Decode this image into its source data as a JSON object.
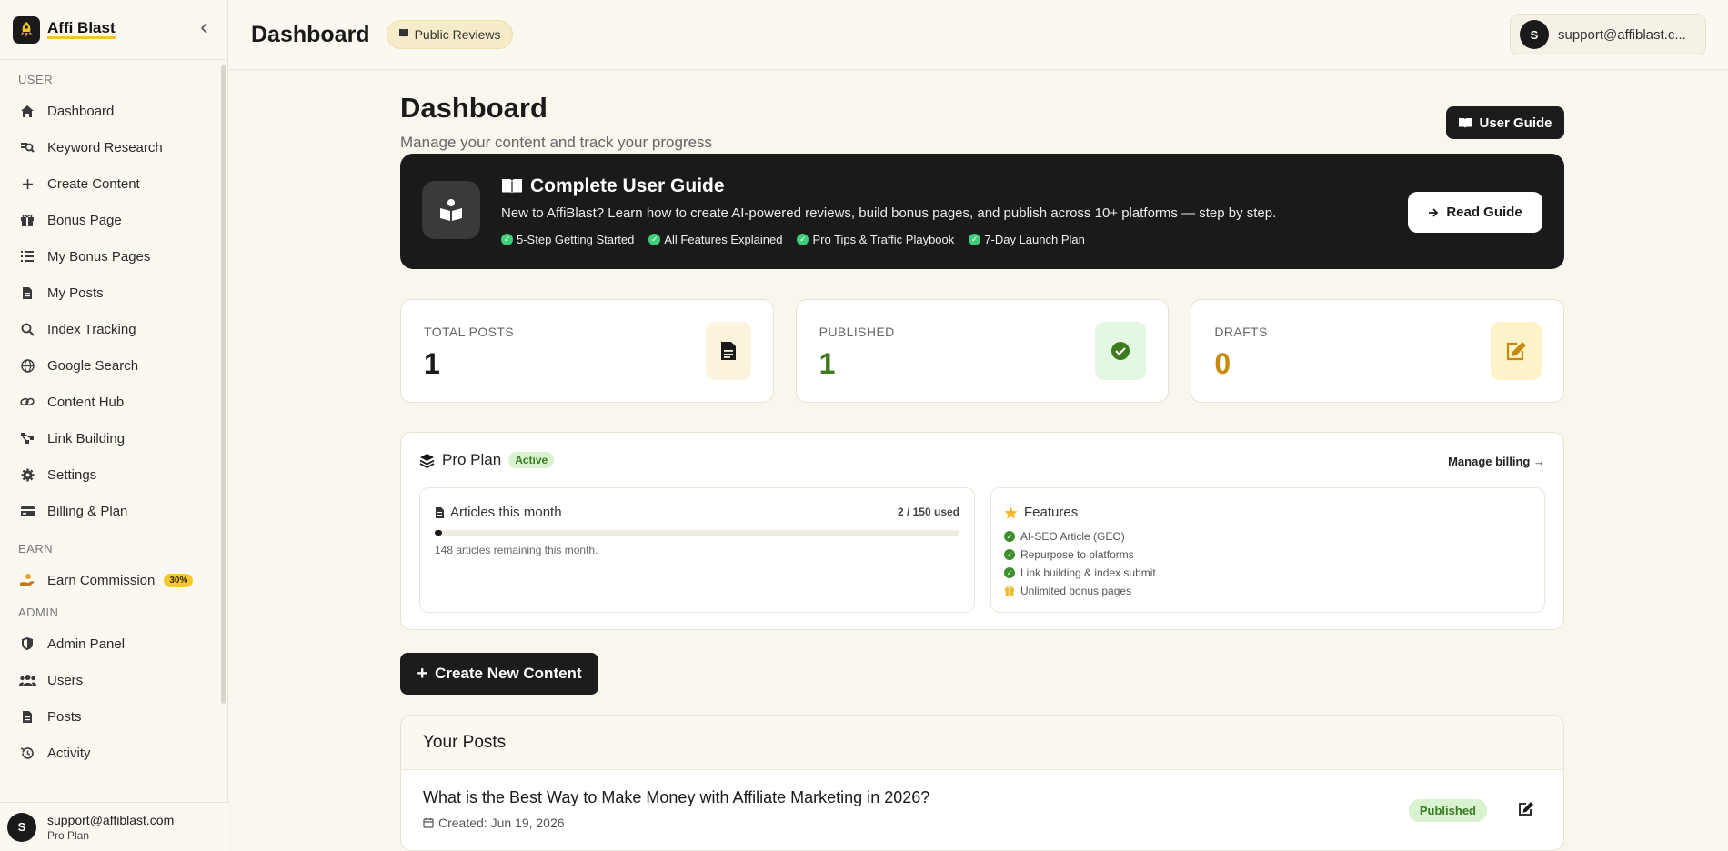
{
  "app": {
    "brand": "Affi Blast"
  },
  "sidebar": {
    "sections": {
      "user": "USER",
      "earn": "EARN",
      "admin": "ADMIN"
    },
    "items": [
      {
        "label": "Dashboard",
        "icon": "home-icon"
      },
      {
        "label": "Keyword Research",
        "icon": "search-doc-icon"
      },
      {
        "label": "Create Content",
        "icon": "plus-icon"
      },
      {
        "label": "Bonus Page",
        "icon": "gift-icon"
      },
      {
        "label": "My Bonus Pages",
        "icon": "list-icon"
      },
      {
        "label": "My Posts",
        "icon": "file-icon"
      },
      {
        "label": "Index Tracking",
        "icon": "search-icon"
      },
      {
        "label": "Google Search",
        "icon": "globe-icon"
      },
      {
        "label": "Content Hub",
        "icon": "link-icon"
      },
      {
        "label": "Link Building",
        "icon": "network-icon"
      },
      {
        "label": "Settings",
        "icon": "gear-icon"
      },
      {
        "label": "Billing & Plan",
        "icon": "card-icon"
      }
    ],
    "earn_items": [
      {
        "label": "Earn Commission",
        "icon": "hand-coin-icon",
        "badge": "30%"
      }
    ],
    "admin_items": [
      {
        "label": "Admin Panel",
        "icon": "shield-icon"
      },
      {
        "label": "Users",
        "icon": "users-icon"
      },
      {
        "label": "Posts",
        "icon": "file-icon"
      },
      {
        "label": "Activity",
        "icon": "history-icon"
      }
    ],
    "footer": {
      "avatar": "S",
      "email": "support@affiblast.com",
      "plan": "Pro Plan"
    }
  },
  "topbar": {
    "title": "Dashboard",
    "pill": "Public Reviews",
    "user_avatar": "S",
    "user_email": "support@affiblast.c..."
  },
  "page": {
    "title": "Dashboard",
    "subtitle": "Manage your content and track your progress",
    "user_guide_button": "User Guide"
  },
  "banner": {
    "title": "Complete User Guide",
    "description": "New to AffiBlast? Learn how to create AI-powered reviews, build bonus pages, and publish across 10+ platforms — step by step.",
    "chips": [
      "5-Step Getting Started",
      "All Features Explained",
      "Pro Tips & Traffic Playbook",
      "7-Day Launch Plan"
    ],
    "button": "Read Guide"
  },
  "stats": [
    {
      "label": "TOTAL POSTS",
      "value": "1",
      "color": "#1a1a1a",
      "icon": "document-icon",
      "icon_bg": "#fbf3dc"
    },
    {
      "label": "PUBLISHED",
      "value": "1",
      "color": "#3d7a1e",
      "icon": "check-circle-icon",
      "icon_bg": "#e3f7e3"
    },
    {
      "label": "DRAFTS",
      "value": "0",
      "color": "#c98a0a",
      "icon": "edit-icon",
      "icon_bg": "#fdf3c9"
    }
  ],
  "plan": {
    "name": "Pro Plan",
    "status": "Active",
    "billing_link": "Manage billing →",
    "usage": {
      "title": "Articles this month",
      "count": "2 / 150 used",
      "progress": 0.013,
      "note": "148 articles remaining this month."
    },
    "features": {
      "title": "Features",
      "items": [
        {
          "label": "AI-SEO Article (GEO)",
          "icon": "check-icon"
        },
        {
          "label": "Repurpose to platforms",
          "icon": "check-icon"
        },
        {
          "label": "Link building & index submit",
          "icon": "check-icon"
        },
        {
          "label": "Unlimited bonus pages",
          "icon": "gift-icon"
        }
      ]
    }
  },
  "create_button": "Create New Content",
  "posts": {
    "title": "Your Posts",
    "rows": [
      {
        "title": "What is the Best Way to Make Money with Affiliate Marketing in 2026?",
        "created": "Created: Jun 19, 2026",
        "status": "Published"
      }
    ]
  },
  "colors": {
    "accent": "#f2c62b",
    "dark": "#1a1a1a",
    "background": "#f9f6ee",
    "success": "#3d8f2b"
  }
}
